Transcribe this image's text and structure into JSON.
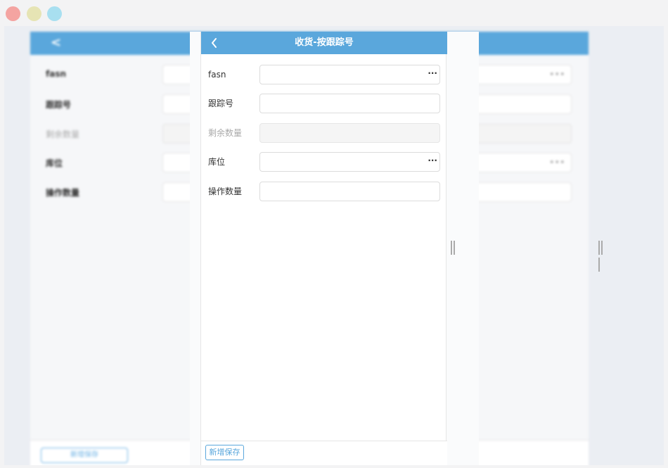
{
  "window": {
    "controls": [
      "close",
      "minimize",
      "maximize"
    ]
  },
  "background": {
    "back_icon": "chevron-left-icon",
    "labels": [
      "fasn",
      "跟踪号",
      "剩余数量",
      "库位",
      "操作数量"
    ],
    "footer_button": "新增保存"
  },
  "nav": {
    "back_icon": "chevron-left-icon",
    "title": "收货-按跟踪号"
  },
  "form": {
    "fasn": {
      "label": "fasn",
      "value": "",
      "more_icon": "ellipsis-icon",
      "more_text": "···"
    },
    "tracking": {
      "label": "跟踪号",
      "value": ""
    },
    "remaining": {
      "label": "剩余数量",
      "value": ""
    },
    "location": {
      "label": "库位",
      "value": "",
      "more_icon": "ellipsis-icon",
      "more_text": "···"
    },
    "operate_qty": {
      "label": "操作数量",
      "value": ""
    }
  },
  "footer": {
    "save_label": "新增保存"
  },
  "colors": {
    "accent": "#5aa7dc",
    "header_text": "#ffffff"
  }
}
